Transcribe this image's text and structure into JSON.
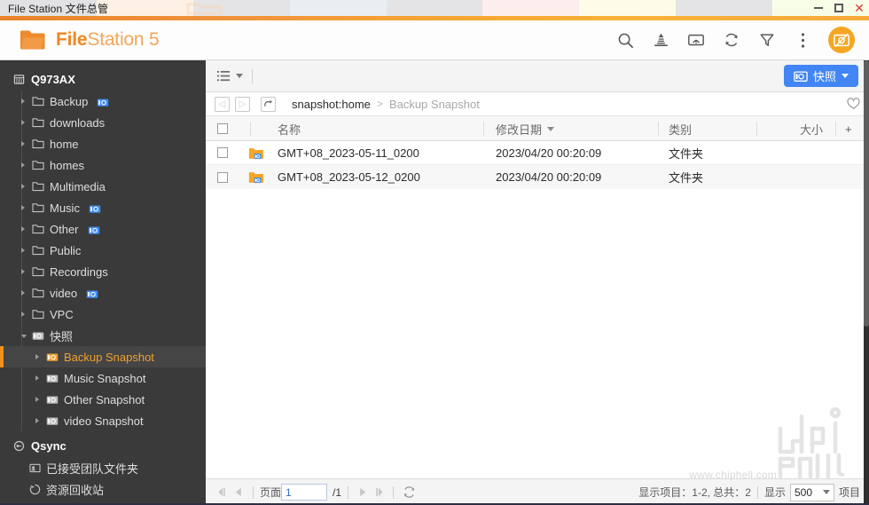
{
  "window": {
    "title": "File Station 文件总管",
    "controls": {
      "minimize": "minimize-icon",
      "maximize": "maximize-icon",
      "close": "close-icon"
    }
  },
  "header": {
    "brand_bold": "File",
    "brand_light": "Station 5",
    "tools": [
      {
        "name": "search-icon",
        "label": "搜索"
      },
      {
        "name": "upload-icon",
        "label": "上传"
      },
      {
        "name": "cast-icon",
        "label": "播放至"
      },
      {
        "name": "refresh-icon",
        "label": "刷新"
      },
      {
        "name": "filter-icon",
        "label": "筛选"
      },
      {
        "name": "more-vertical-icon",
        "label": "更多"
      }
    ],
    "badge": "snapshot-app-icon"
  },
  "sidebar": {
    "root": {
      "label": "Q973AX",
      "icon": "nas-icon"
    },
    "items": [
      {
        "label": "Backup",
        "icon": "folder-icon",
        "snapshot_badge": true,
        "level": 1
      },
      {
        "label": "downloads",
        "icon": "folder-icon",
        "snapshot_badge": false,
        "level": 1
      },
      {
        "label": "home",
        "icon": "folder-icon",
        "snapshot_badge": false,
        "level": 1
      },
      {
        "label": "homes",
        "icon": "folder-icon",
        "snapshot_badge": false,
        "level": 1
      },
      {
        "label": "Multimedia",
        "icon": "folder-icon",
        "snapshot_badge": false,
        "level": 1
      },
      {
        "label": "Music",
        "icon": "folder-icon",
        "snapshot_badge": true,
        "level": 1
      },
      {
        "label": "Other",
        "icon": "folder-icon",
        "snapshot_badge": true,
        "level": 1
      },
      {
        "label": "Public",
        "icon": "folder-icon",
        "snapshot_badge": false,
        "level": 1
      },
      {
        "label": "Recordings",
        "icon": "folder-icon",
        "snapshot_badge": false,
        "level": 1
      },
      {
        "label": "video",
        "icon": "folder-icon",
        "snapshot_badge": true,
        "level": 1
      },
      {
        "label": "VPC",
        "icon": "folder-icon",
        "snapshot_badge": false,
        "level": 1
      },
      {
        "label": "快照",
        "icon": "camera-icon",
        "snapshot_badge": false,
        "level": 1,
        "expanded": true
      },
      {
        "label": "Backup Snapshot",
        "icon": "camera-icon",
        "snapshot_badge": false,
        "level": 2,
        "selected": true
      },
      {
        "label": "Music Snapshot",
        "icon": "camera-icon",
        "snapshot_badge": false,
        "level": 2
      },
      {
        "label": "Other Snapshot",
        "icon": "camera-icon",
        "snapshot_badge": false,
        "level": 2
      },
      {
        "label": "video Snapshot",
        "icon": "camera-icon",
        "snapshot_badge": false,
        "level": 2
      }
    ],
    "qsync": {
      "label": "Qsync",
      "icon": "qsync-icon"
    },
    "qsync_items": [
      {
        "label": "已接受团队文件夹",
        "icon": "team-folder-icon"
      },
      {
        "label": "资源回收站",
        "icon": "recycle-bin-icon"
      }
    ]
  },
  "content_toolbar": {
    "view_mode": "list-view-icon",
    "snapshot_button": {
      "label": "快照",
      "icon": "camera-icon",
      "color": "#4285f4"
    }
  },
  "breadcrumb": {
    "back": "back-icon",
    "forward": "forward-icon",
    "up": "up-icon",
    "path_root": "snapshot:home",
    "separator": ">",
    "path_current": "Backup Snapshot",
    "favorite": "heart-icon"
  },
  "table": {
    "columns": [
      "名称",
      "修改日期",
      "类别",
      "大小"
    ],
    "sorted_column": "修改日期",
    "add_column": "+",
    "rows": [
      {
        "name": "GMT+08_2023-05-11_0200",
        "modified": "2023/04/20 00:20:09",
        "type": "文件夹",
        "size": ""
      },
      {
        "name": "GMT+08_2023-05-12_0200",
        "modified": "2023/04/20 00:20:09",
        "type": "文件夹",
        "size": ""
      }
    ]
  },
  "footer": {
    "first_page_icon": "first-page-icon",
    "prev_page_icon": "prev-page-icon",
    "page_label": "页面",
    "page_value": "1",
    "page_total": "/1",
    "next_page_icon": "next-page-icon",
    "last_page_icon": "last-page-icon",
    "refresh_icon": "refresh-icon",
    "items_info": "显示项目：1-2, 总共：2",
    "show_label": "显示",
    "page_size": "500",
    "items_suffix": "项目"
  },
  "watermark": {
    "url": "www.chiphell.com",
    "logo": "chiphell-logo"
  },
  "colors": {
    "accent_orange": "#f0901e",
    "brand_orange": "#f08a2a",
    "snapshot_blue": "#4285f4",
    "sidebar_bg": "#3a3a3a",
    "selected_text": "#f0a030"
  }
}
